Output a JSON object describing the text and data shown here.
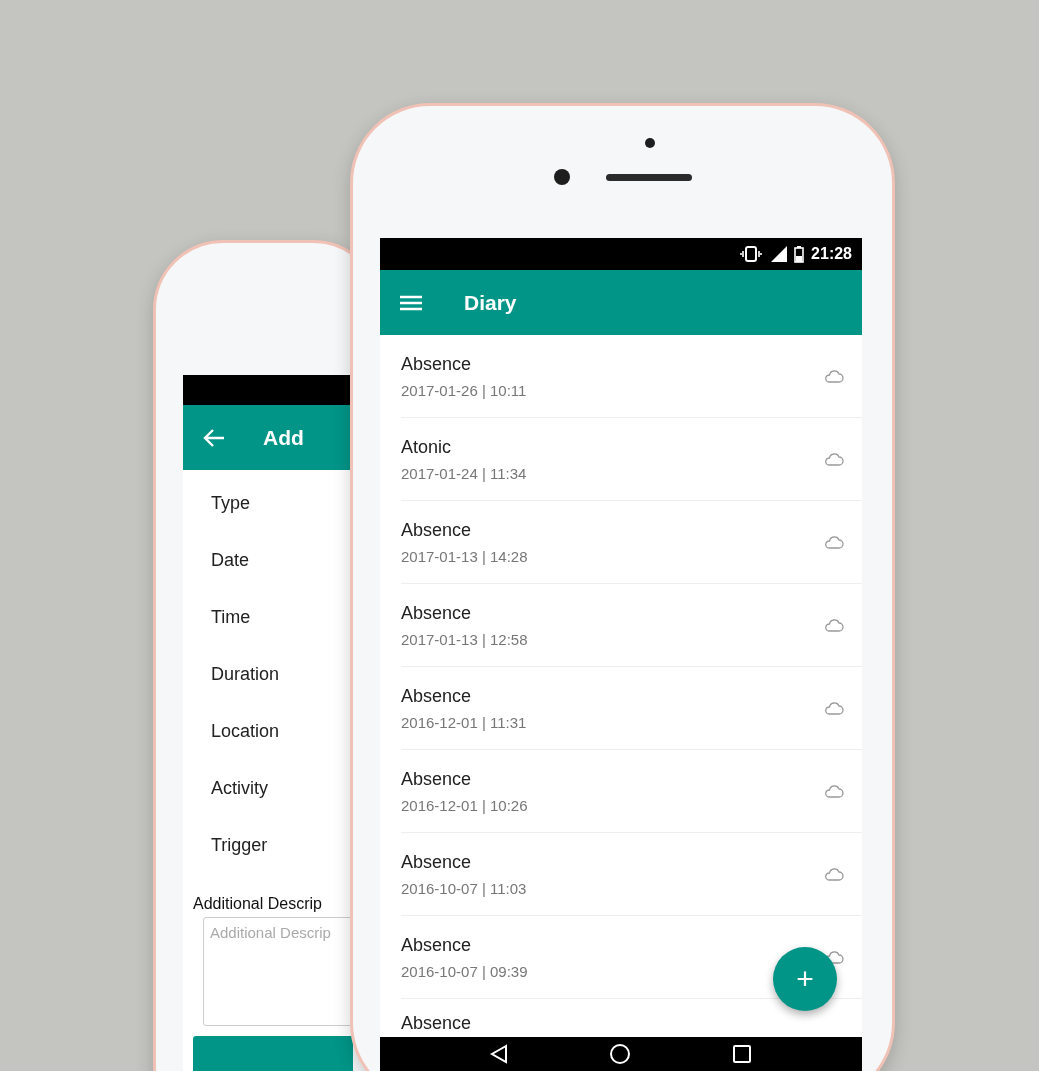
{
  "back_phone": {
    "app_bar": {
      "title": "Add"
    },
    "fields": [
      "Type",
      "Date",
      "Time",
      "Duration",
      "Location",
      "Activity",
      "Trigger"
    ],
    "description": {
      "label": "Additional Descrip",
      "placeholder": "Additional Descrip"
    }
  },
  "front_phone": {
    "status_bar": {
      "time": "21:28"
    },
    "app_bar": {
      "title": "Diary"
    },
    "entries": [
      {
        "title": "Absence",
        "date": "2017-01-26 | 10:11"
      },
      {
        "title": "Atonic",
        "date": "2017-01-24 | 11:34"
      },
      {
        "title": "Absence",
        "date": "2017-01-13 | 14:28"
      },
      {
        "title": "Absence",
        "date": "2017-01-13 | 12:58"
      },
      {
        "title": "Absence",
        "date": "2016-12-01 | 11:31"
      },
      {
        "title": "Absence",
        "date": "2016-12-01 | 10:26"
      },
      {
        "title": "Absence",
        "date": "2016-10-07 | 11:03"
      },
      {
        "title": "Absence",
        "date": "2016-10-07 | 09:39"
      },
      {
        "title": "Absence"
      }
    ],
    "fab": {
      "label": "+"
    }
  }
}
